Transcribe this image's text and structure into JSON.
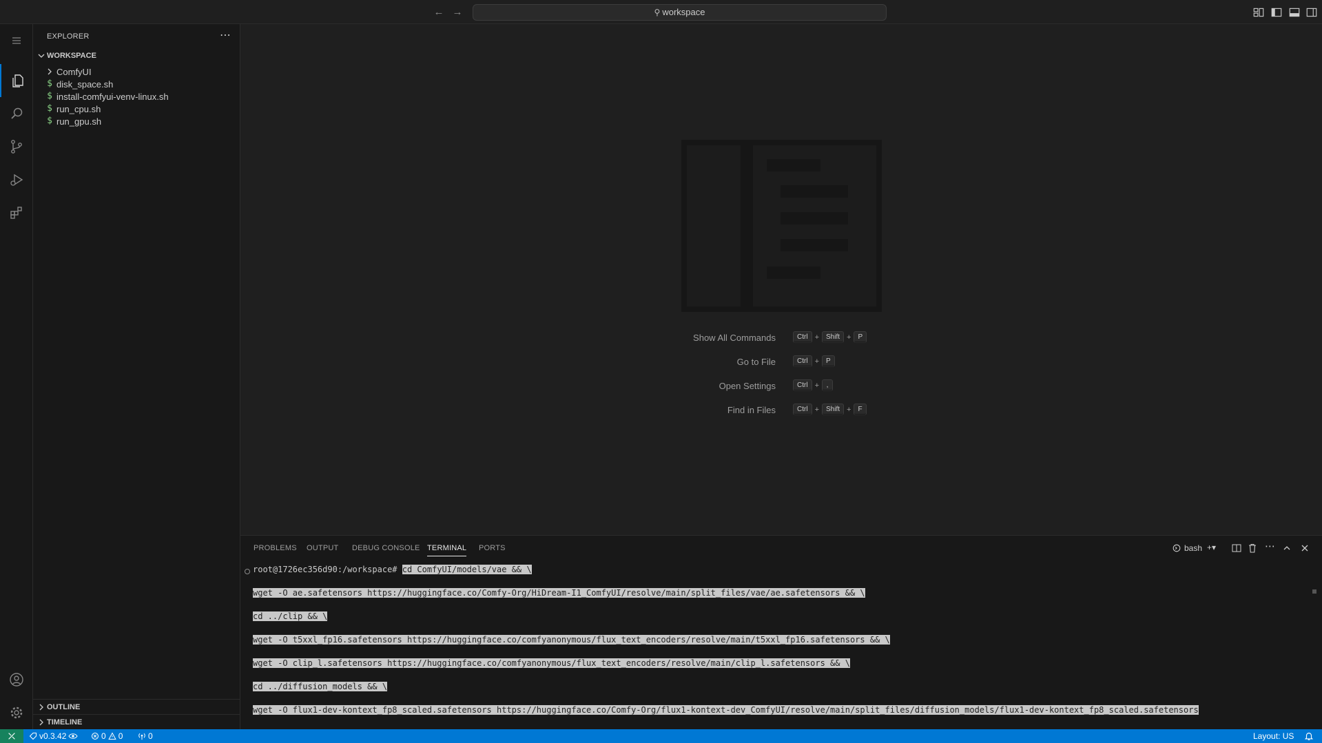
{
  "titlebar": {
    "search_text": "workspace"
  },
  "sidebar": {
    "title": "EXPLORER",
    "workspace_label": "WORKSPACE",
    "items": [
      {
        "label": "ComfyUI",
        "type": "folder"
      },
      {
        "label": "disk_space.sh",
        "type": "shell"
      },
      {
        "label": "install-comfyui-venv-linux.sh",
        "type": "shell"
      },
      {
        "label": "run_cpu.sh",
        "type": "shell"
      },
      {
        "label": "run_gpu.sh",
        "type": "shell"
      }
    ],
    "shell_icon_glyph": "$",
    "outline_label": "OUTLINE",
    "timeline_label": "TIMELINE"
  },
  "editor": {
    "shortcuts": [
      {
        "label": "Show All Commands",
        "keys": [
          "Ctrl",
          "Shift",
          "P"
        ]
      },
      {
        "label": "Go to File",
        "keys": [
          "Ctrl",
          "P"
        ]
      },
      {
        "label": "Open Settings",
        "keys": [
          "Ctrl",
          ","
        ]
      },
      {
        "label": "Find in Files",
        "keys": [
          "Ctrl",
          "Shift",
          "F"
        ]
      }
    ]
  },
  "panel": {
    "tabs": [
      "PROBLEMS",
      "OUTPUT",
      "DEBUG CONSOLE",
      "TERMINAL",
      "PORTS"
    ],
    "active_tab": "TERMINAL",
    "terminal_name": "bash",
    "terminal": {
      "prompt": "root@1726ec356d90:/workspace#",
      "lines": [
        "cd ComfyUI/models/vae && \\",
        "wget -O ae.safetensors https://huggingface.co/Comfy-Org/HiDream-I1_ComfyUI/resolve/main/split_files/vae/ae.safetensors && \\",
        "cd ../clip && \\",
        "wget -O t5xxl_fp16.safetensors https://huggingface.co/comfyanonymous/flux_text_encoders/resolve/main/t5xxl_fp16.safetensors && \\",
        "wget -O clip_l.safetensors https://huggingface.co/comfyanonymous/flux_text_encoders/resolve/main/clip_l.safetensors && \\",
        "cd ../diffusion_models && \\",
        "wget -O flux1-dev-kontext_fp8_scaled.safetensors https://huggingface.co/Comfy-Org/flux1-kontext-dev_ComfyUI/resolve/main/split_files/diffusion_models/flux1-dev-kontext_fp8_scaled.safetensors"
      ]
    }
  },
  "statusbar": {
    "version": "v0.3.42",
    "errors": "0",
    "warnings": "0",
    "ports": "0",
    "layout": "Layout: US"
  },
  "colors": {
    "accent": "#0078d4",
    "remote": "#16825d",
    "shell_icon": "#89d185"
  }
}
